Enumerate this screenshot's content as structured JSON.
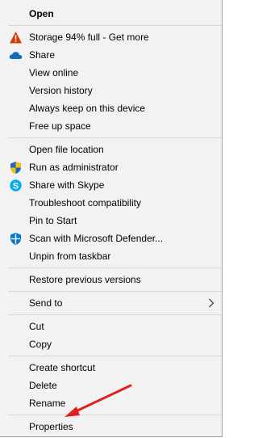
{
  "menu": {
    "open": "Open",
    "storage": "Storage 94% full - Get more",
    "share": "Share",
    "view_online": "View online",
    "version_history": "Version history",
    "always_keep": "Always keep on this device",
    "free_up": "Free up space",
    "open_file_location": "Open file location",
    "run_as_admin": "Run as administrator",
    "share_skype": "Share with Skype",
    "troubleshoot": "Troubleshoot compatibility",
    "pin_to_start": "Pin to Start",
    "scan_defender": "Scan with Microsoft Defender...",
    "unpin_taskbar": "Unpin from taskbar",
    "restore_versions": "Restore previous versions",
    "send_to": "Send to",
    "cut": "Cut",
    "copy": "Copy",
    "create_shortcut": "Create shortcut",
    "delete": "Delete",
    "rename": "Rename",
    "properties": "Properties"
  },
  "colors": {
    "menu_bg": "#f2f2f2",
    "separator": "#d8d8d8",
    "annotation_arrow": "#e0201f",
    "warning": "#d83b01",
    "onedrive": "#0f6cbd",
    "skype": "#00aff0",
    "defender": "#0078d4"
  },
  "icons": {
    "storage": "warning-triangle-icon",
    "share": "onedrive-cloud-icon",
    "run_as_admin": "uac-shield-icon",
    "share_skype": "skype-icon",
    "scan_defender": "defender-icon",
    "send_to": "chevron-right-icon"
  }
}
